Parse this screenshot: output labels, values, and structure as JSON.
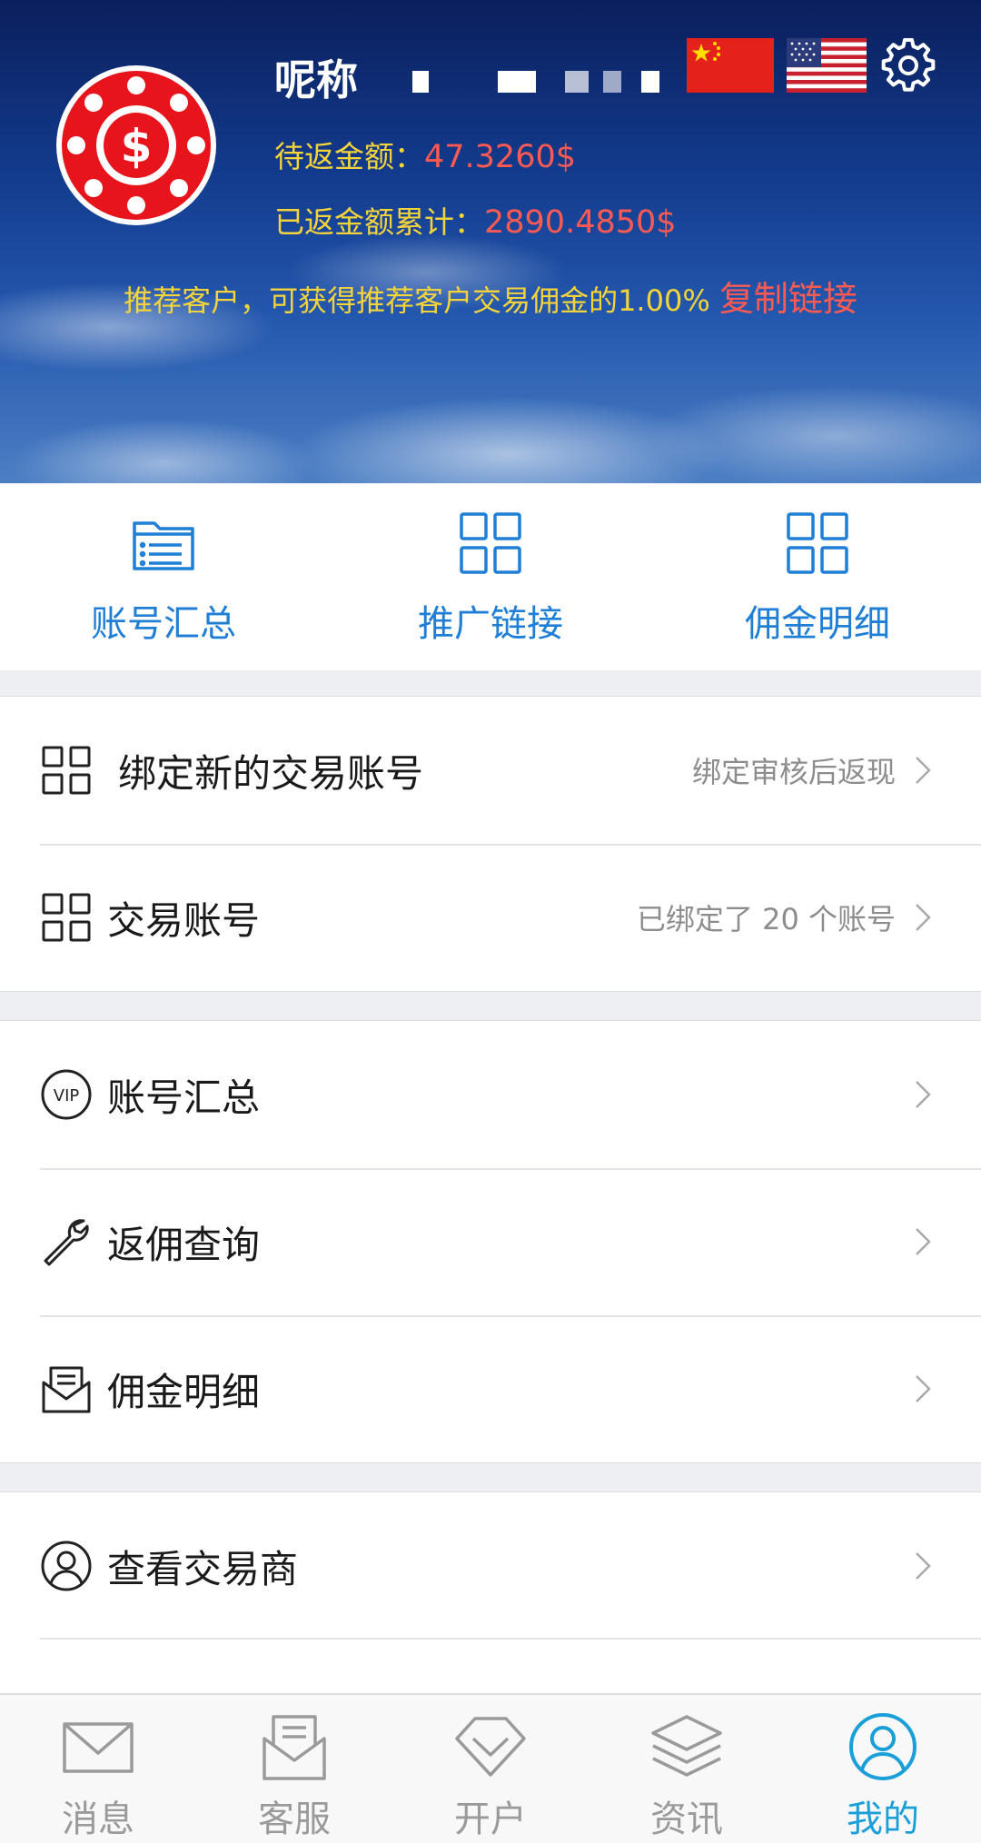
{
  "profile": {
    "nickname_label": "呢称",
    "pending_label": "待返金额：",
    "pending_value": "47.3260$",
    "returned_label": "已返金额累计：",
    "returned_value": "2890.4850$"
  },
  "referral": {
    "text": "推荐客户，可获得推荐客户交易佣金的1.00% ",
    "link_label": "复制链接"
  },
  "header_icons": [
    "china-flag-icon",
    "us-flag-icon",
    "gear-icon"
  ],
  "quick_actions": [
    {
      "label": "账号汇总",
      "icon": "folder-list-icon"
    },
    {
      "label": "推广链接",
      "icon": "grid-icon"
    },
    {
      "label": "佣金明细",
      "icon": "grid-icon"
    }
  ],
  "section1": [
    {
      "label": "绑定新的交易账号",
      "hint": "绑定审核后返现",
      "icon": "grid-icon"
    },
    {
      "label": "交易账号",
      "hint": "已绑定了 20 个账号",
      "icon": "grid-icon"
    }
  ],
  "section2": [
    {
      "label": "账号汇总",
      "icon": "vip-icon"
    },
    {
      "label": "返佣查询",
      "icon": "wrench-icon"
    },
    {
      "label": "佣金明细",
      "icon": "mail-icon"
    }
  ],
  "section3": [
    {
      "label": "查看交易商",
      "icon": "user-circle-icon"
    }
  ],
  "bottom_nav": [
    {
      "label": "消息",
      "icon": "envelope-icon",
      "active": false
    },
    {
      "label": "客服",
      "icon": "open-mail-icon",
      "active": false
    },
    {
      "label": "开户",
      "icon": "diamond-icon",
      "active": false
    },
    {
      "label": "资讯",
      "icon": "layers-icon",
      "active": false
    },
    {
      "label": "我的",
      "icon": "user-circle-icon",
      "active": true
    }
  ],
  "colors": {
    "accent_blue": "#1f7fd6",
    "nav_active": "#1a9fd8",
    "amount_red": "#ff5a52",
    "label_yellow": "#f5d43a"
  }
}
